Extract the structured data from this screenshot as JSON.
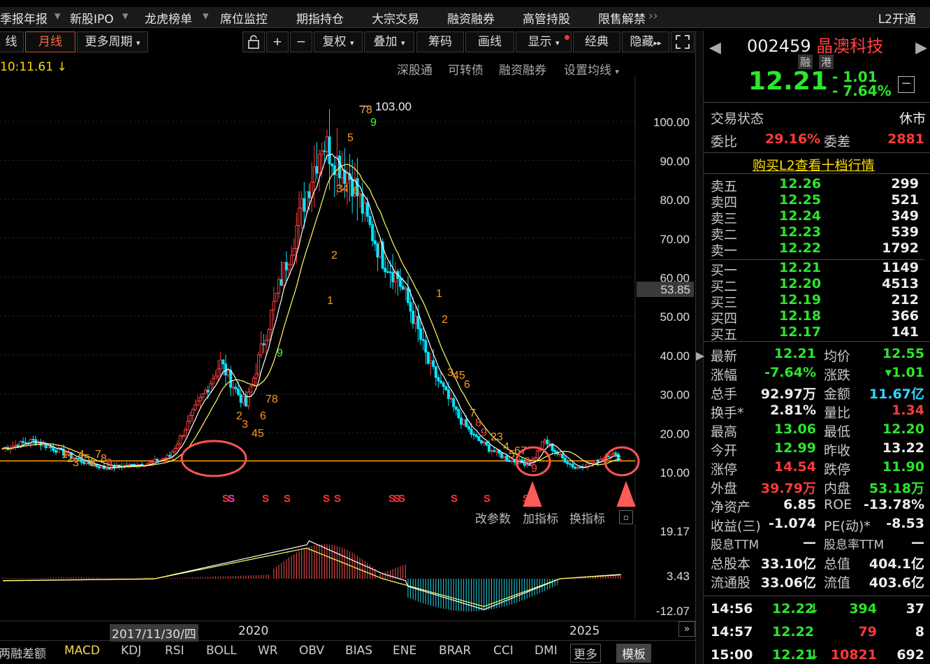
{
  "topmenu": {
    "items": [
      "季报年报",
      "新股IPO",
      "龙虎榜单",
      "席位监控",
      "期指持仓",
      "大宗交易",
      "融资融券",
      "高管持股",
      "限售解禁"
    ],
    "right": "L2开通"
  },
  "toolbar": {
    "left_stub": "线",
    "period": "月线",
    "more_period": "更多周期",
    "plus": "+",
    "minus": "−",
    "adjust": "复权",
    "overlay": "叠加",
    "chips": "筹码",
    "draw": "画线",
    "display": "显示",
    "classic": "经典",
    "hide": "隐藏"
  },
  "subbar": {
    "time": "10:11.61",
    "links": [
      "深股通",
      "可转债",
      "融资融券",
      "设置均线"
    ]
  },
  "chart_data": {
    "type": "candlestick",
    "title": "",
    "period": "月线",
    "ylim": [
      0,
      110
    ],
    "yticks": [
      10,
      20,
      30,
      40,
      50,
      60,
      70,
      80,
      90,
      100
    ],
    "ytick_labels": [
      "10.00",
      "20.00",
      "30.00",
      "40.00",
      "50.00",
      "60.00",
      "70.00",
      "80.00",
      "90.00",
      "100.00"
    ],
    "cursor_label": "53.85",
    "high_label": "103.00",
    "high_value": 103.0,
    "support_line": 12.8,
    "xlabels": [
      "2017/11/30/四",
      "2020",
      "2025"
    ],
    "macd_yticks": [
      "19.17",
      "3.43",
      "-12.07"
    ]
  },
  "macdbar": {
    "links": [
      "改参数",
      "加指标",
      "换指标"
    ]
  },
  "bottomtabs": {
    "items": [
      "两融差额",
      "MACD",
      "KDJ",
      "RSI",
      "BOLL",
      "WR",
      "OBV",
      "BIAS",
      "ENE",
      "BRAR",
      "CCI",
      "DMI",
      "更多",
      "模板"
    ]
  },
  "panel": {
    "code": "002459",
    "name": "晶澳科技",
    "tag_rong": "融",
    "tag_gang": "港",
    "price": "12.21",
    "change": "- 1.01",
    "pct": "- 7.64%",
    "trade_state_label": "交易状态",
    "trade_state": "休市",
    "weibi_label": "委比",
    "weibi": "29.16%",
    "weicha_label": "委差",
    "weicha": "2881",
    "l2_link": "购买L2查看十档行情",
    "asks": [
      {
        "l": "卖五",
        "p": "12.26",
        "v": "299"
      },
      {
        "l": "卖四",
        "p": "12.25",
        "v": "521"
      },
      {
        "l": "卖三",
        "p": "12.24",
        "v": "349"
      },
      {
        "l": "卖二",
        "p": "12.23",
        "v": "539"
      },
      {
        "l": "卖一",
        "p": "12.22",
        "v": "1792"
      }
    ],
    "bids": [
      {
        "l": "买一",
        "p": "12.21",
        "v": "1149"
      },
      {
        "l": "买二",
        "p": "12.20",
        "v": "4513"
      },
      {
        "l": "买三",
        "p": "12.19",
        "v": "212"
      },
      {
        "l": "买四",
        "p": "12.18",
        "v": "366"
      },
      {
        "l": "买五",
        "p": "12.17",
        "v": "141"
      }
    ],
    "stats": [
      [
        "最新",
        "12.21",
        "均价",
        "12.55"
      ],
      [
        "涨幅",
        "-7.64%",
        "涨跌",
        "▾1.01"
      ],
      [
        "总手",
        "92.97万",
        "金额",
        "11.67亿"
      ],
      [
        "换手*",
        "2.81%",
        "量比",
        "1.34"
      ],
      [
        "最高",
        "13.06",
        "最低",
        "12.20"
      ],
      [
        "今开",
        "12.99",
        "昨收",
        "13.22"
      ],
      [
        "涨停",
        "14.54",
        "跌停",
        "11.90"
      ],
      [
        "外盘",
        "39.79万",
        "内盘",
        "53.18万"
      ],
      [
        "净资产",
        "6.85",
        "ROE",
        "-13.78%"
      ],
      [
        "收益(三)",
        "-1.074",
        "PE(动)*",
        "-8.53"
      ],
      [
        "股息TTM",
        "—",
        "股息率TTM",
        "—"
      ],
      [
        "总股本",
        "33.10亿",
        "总值",
        "404.1亿"
      ],
      [
        "流通股",
        "33.06亿",
        "流值",
        "403.6亿"
      ]
    ],
    "ticks": [
      {
        "t": "14:56",
        "p": "12.22",
        "a": "↓",
        "v": "394",
        "n": "37"
      },
      {
        "t": "14:57",
        "p": "12.22",
        "a": "",
        "v": "79",
        "n": "8"
      },
      {
        "t": "15:00",
        "p": "12.21",
        "a": "↓",
        "v": "10821",
        "n": "692"
      }
    ]
  },
  "colors": {
    "up": "#ff3b3b",
    "down": "#00e5ff",
    "ma1": "#ffffff",
    "ma2": "#ffff66",
    "support": "#ff9900",
    "circle": "#ff5555"
  }
}
